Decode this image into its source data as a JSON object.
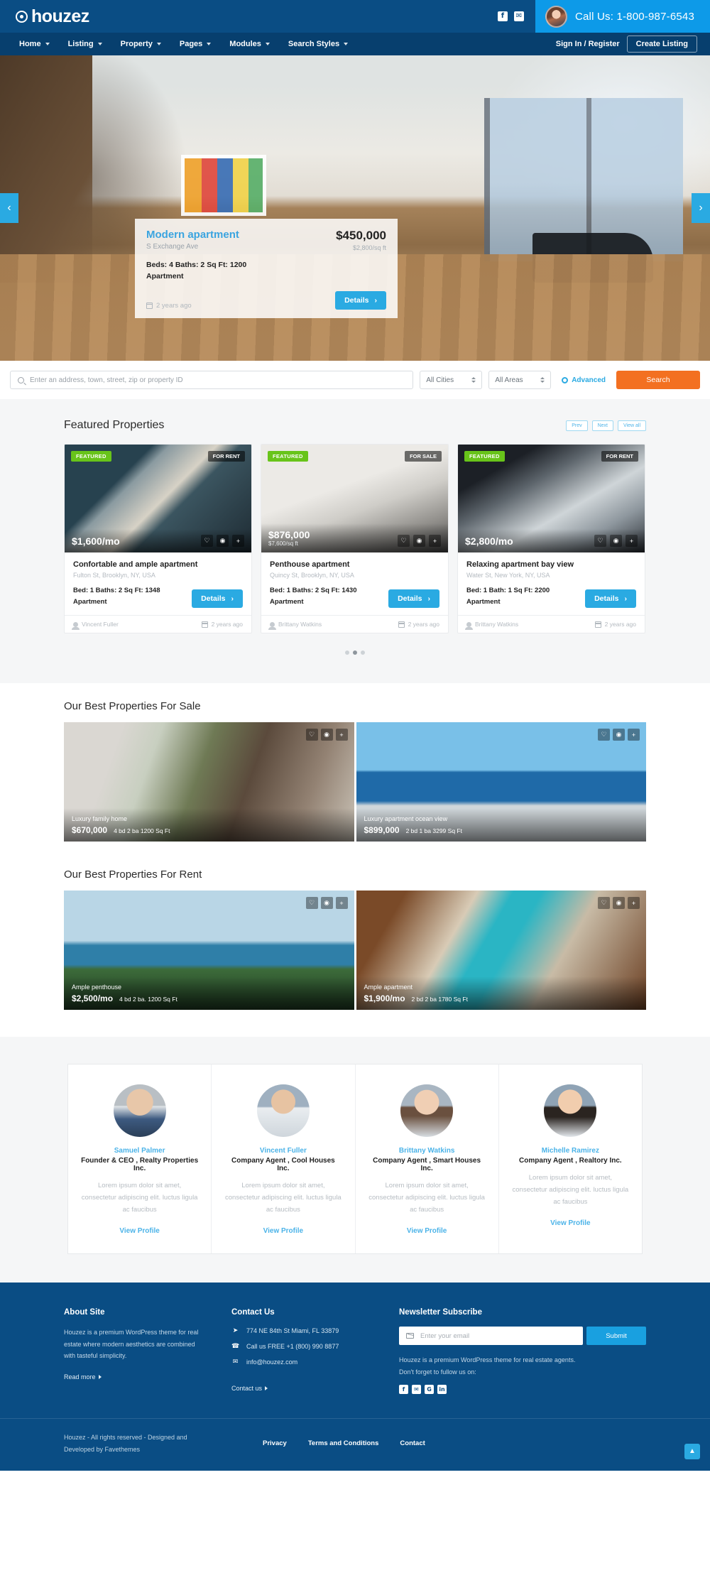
{
  "brand": {
    "name": "houzez",
    "logo_icon": "location-pin-icon"
  },
  "topbar": {
    "social": [
      {
        "name": "facebook-icon",
        "glyph": "f"
      },
      {
        "name": "twitter-icon",
        "glyph": "✉"
      }
    ],
    "call_label": "Call Us: 1-800-987-6543"
  },
  "nav": {
    "items": [
      {
        "label": "Home"
      },
      {
        "label": "Listing"
      },
      {
        "label": "Property"
      },
      {
        "label": "Pages"
      },
      {
        "label": "Modules"
      },
      {
        "label": "Search Styles"
      }
    ],
    "signin_label": "Sign In / Register",
    "create_listing_label": "Create Listing"
  },
  "hero": {
    "prev_glyph": "‹",
    "next_glyph": "›",
    "card": {
      "title": "Modern apartment",
      "address": "S Exchange Ave",
      "price": "$450,000",
      "price_per_sqft": "$2,800/sq ft",
      "meta_line1": "Beds: 4   Baths: 2   Sq Ft: 1200",
      "meta_line2": "Apartment",
      "posted": "2 years ago",
      "details_label": "Details",
      "details_arrow": "›"
    }
  },
  "search": {
    "placeholder": "Enter an address, town, street, zip or property ID",
    "value": "",
    "city_select": "All Cities",
    "area_select": "All Areas",
    "advanced_label": "Advanced",
    "search_label": "Search"
  },
  "featured": {
    "title": "Featured Properties",
    "pager": {
      "prev": "Prev",
      "next": "Next",
      "view_all": "View all"
    },
    "cards": [
      {
        "badge": "FEATURED",
        "status": "FOR RENT",
        "price": "$1,600/mo",
        "price_per_sqft": "",
        "title": "Confortable and ample apartment",
        "address": "Fulton St, Brooklyn, NY, USA",
        "meta_line1": "Bed: 1   Baths: 2   Sq Ft: 1348",
        "meta_line2": "Apartment",
        "details_label": "Details",
        "agent": "Vincent Fuller",
        "posted": "2 years ago"
      },
      {
        "badge": "FEATURED",
        "status": "FOR SALE",
        "price": "$876,000",
        "price_per_sqft": "$7,600/sq ft",
        "title": "Penthouse apartment",
        "address": "Quincy St, Brooklyn, NY, USA",
        "meta_line1": "Bed: 1   Baths: 2   Sq Ft: 1430",
        "meta_line2": "Apartment",
        "details_label": "Details",
        "agent": "Brittany Watkins",
        "posted": "2 years ago"
      },
      {
        "badge": "FEATURED",
        "status": "FOR RENT",
        "price": "$2,800/mo",
        "price_per_sqft": "",
        "title": "Relaxing apartment bay view",
        "address": "Water St, New York, NY, USA",
        "meta_line1": "Bed: 1   Bath: 1   Sq Ft: 2200",
        "meta_line2": "Apartment",
        "details_label": "Details",
        "agent": "Brittany Watkins",
        "posted": "2 years ago"
      }
    ],
    "dots": 3,
    "active_dot": 2
  },
  "for_sale": {
    "title": "Our Best Properties For Sale",
    "items": [
      {
        "title": "Luxury family home",
        "price": "$670,000",
        "meta": "4 bd   2 ba   1200 Sq Ft"
      },
      {
        "title": "Luxury apartment ocean view",
        "price": "$899,000",
        "meta": "2 bd   1 ba   3299 Sq Ft"
      }
    ]
  },
  "for_rent": {
    "title": "Our Best Properties For Rent",
    "items": [
      {
        "title": "Ample penthouse",
        "price": "$2,500/mo",
        "meta": "4 bd   2 ba.   1200 Sq Ft"
      },
      {
        "title": "Ample apartment",
        "price": "$1,900/mo",
        "meta": "2 bd   2 ba   1780 Sq Ft"
      }
    ]
  },
  "card_actions": {
    "favorite": "♡",
    "photos": "◉",
    "compare": "+"
  },
  "agents": [
    {
      "name": "Samuel Palmer",
      "role": "Founder & CEO , Realty Properties Inc.",
      "desc": "Lorem ipsum dolor sit amet, consectetur adipiscing elit. luctus ligula ac faucibus",
      "link": "View Profile"
    },
    {
      "name": "Vincent Fuller",
      "role": "Company Agent , Cool Houses Inc.",
      "desc": "Lorem ipsum dolor sit amet, consectetur adipiscing elit. luctus ligula ac faucibus",
      "link": "View Profile"
    },
    {
      "name": "Brittany Watkins",
      "role": "Company Agent , Smart Houses Inc.",
      "desc": "Lorem ipsum dolor sit amet, consectetur adipiscing elit. luctus ligula ac faucibus",
      "link": "View Profile"
    },
    {
      "name": "Michelle Ramirez",
      "role": "Company Agent , Realtory Inc.",
      "desc": "Lorem ipsum dolor sit amet, consectetur adipiscing elit. luctus ligula ac faucibus",
      "link": "View Profile"
    }
  ],
  "footer": {
    "about": {
      "title": "About Site",
      "text": "Houzez is a premium WordPress theme for real estate where modern aesthetics are combined with tasteful simplicity.",
      "link": "Read more"
    },
    "contact": {
      "title": "Contact Us",
      "address": "774 NE 84th St Miami, FL 33879",
      "phone": "Call us FREE +1 (800) 990 8877",
      "email": "info@houzez.com",
      "link": "Contact us"
    },
    "newsletter": {
      "title": "Newsletter Subscribe",
      "placeholder": "Enter your email",
      "value": "",
      "submit_label": "Submit",
      "note_line1": "Houzez is a premium WordPress theme for real estate agents.",
      "note_line2": "Don't forget to fullow us on:",
      "social": [
        {
          "name": "facebook-icon",
          "glyph": "f"
        },
        {
          "name": "twitter-icon",
          "glyph": "✉"
        },
        {
          "name": "google-plus-icon",
          "glyph": "G"
        },
        {
          "name": "linkedin-icon",
          "glyph": "in"
        }
      ]
    },
    "copyright": "Houzez - All rights reserved - Designed and Developed by Favethemes",
    "links": [
      {
        "label": "Privacy"
      },
      {
        "label": "Terms and Conditions"
      },
      {
        "label": "Contact"
      }
    ],
    "to_top_glyph": "▲"
  },
  "colors": {
    "brand_dark": "#0a4d84",
    "nav_dark": "#073f6e",
    "accent_blue": "#2aaae2",
    "accent_orange": "#f37021",
    "badge_green": "#68c41a"
  }
}
